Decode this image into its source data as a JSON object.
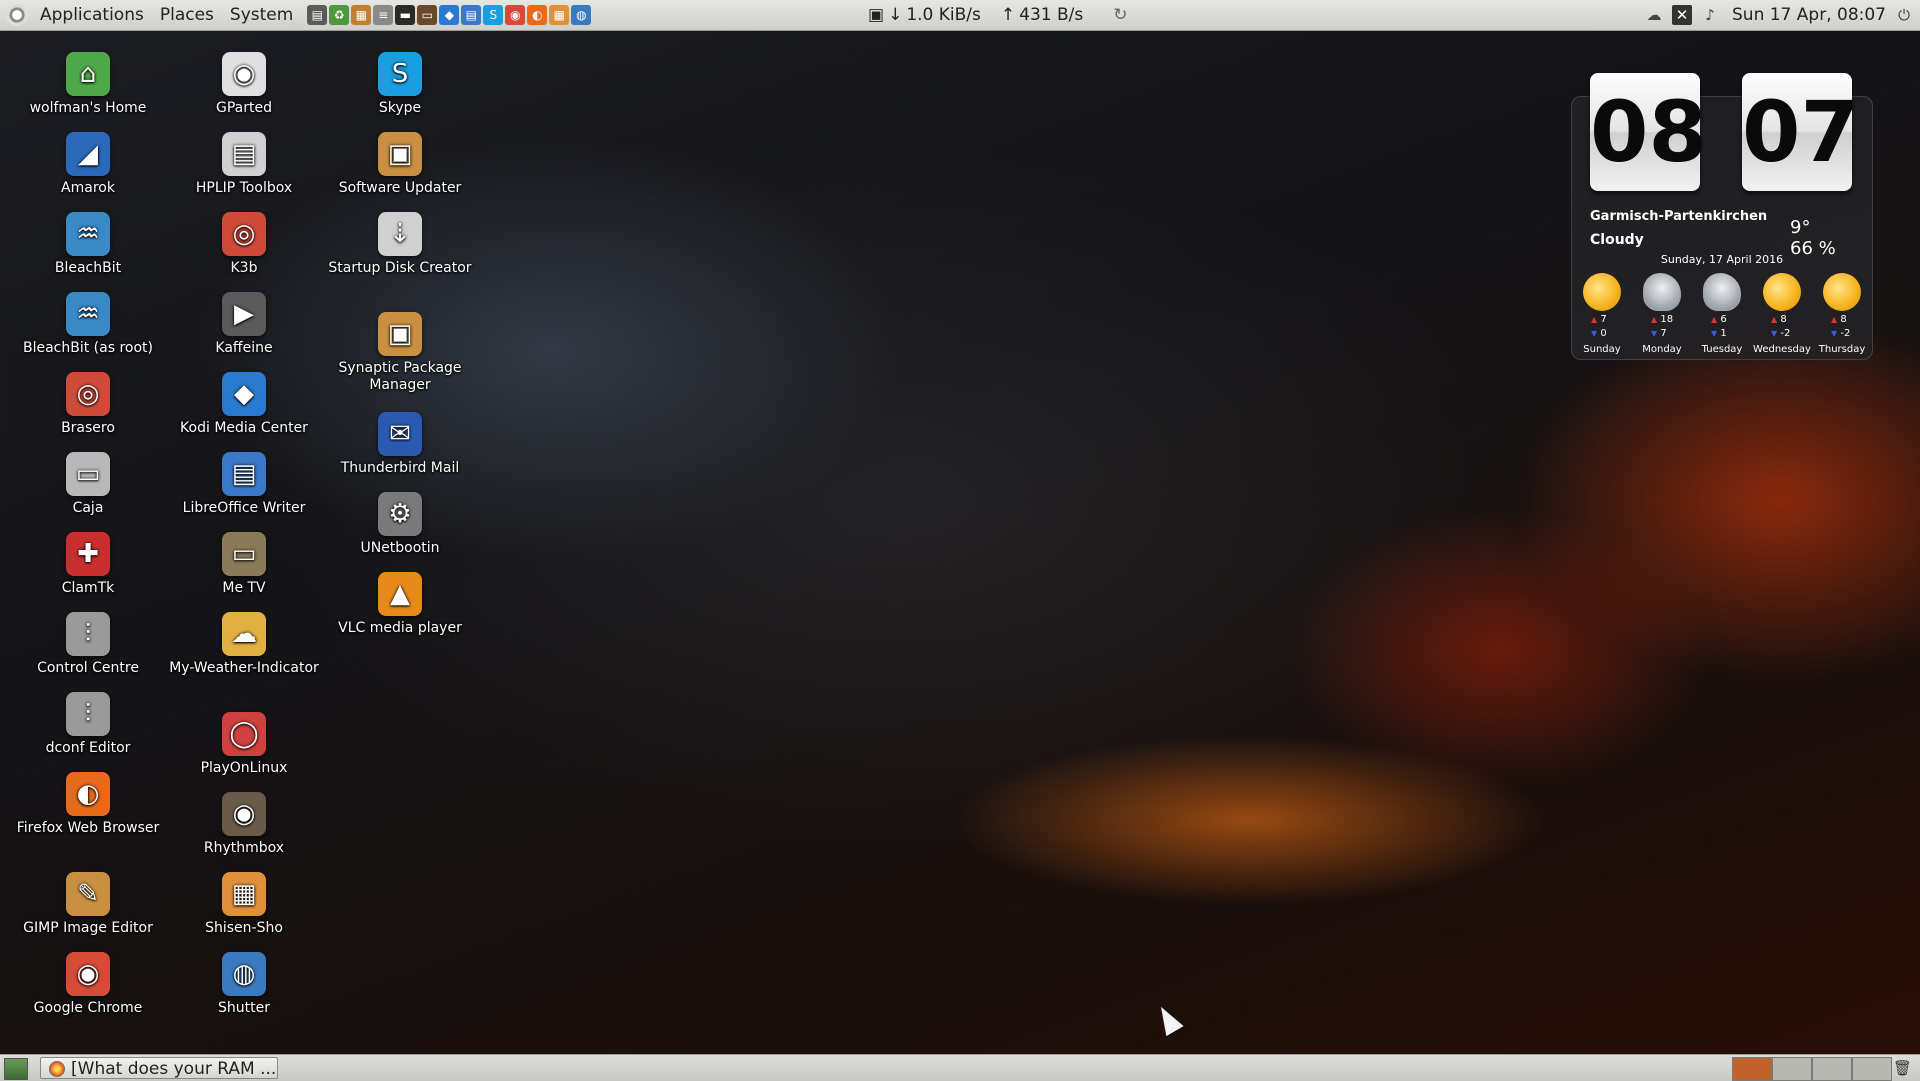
{
  "top_panel": {
    "menus": [
      "Applications",
      "Places",
      "System"
    ],
    "launchers": [
      {
        "icon": "terminal-icon",
        "glyph": "▤",
        "color": "#5a5a5a"
      },
      {
        "icon": "recycle-icon",
        "glyph": "♻",
        "color": "#4d9a3a"
      },
      {
        "icon": "image-viewer-icon",
        "glyph": "▦",
        "color": "#c08030"
      },
      {
        "icon": "text-editor-icon",
        "glyph": "≡",
        "color": "#8a8a8a"
      },
      {
        "icon": "console-icon",
        "glyph": "▬",
        "color": "#2a2a2a"
      },
      {
        "icon": "monitor-icon",
        "glyph": "▭",
        "color": "#6a4a2a"
      },
      {
        "icon": "kodi-icon",
        "glyph": "◆",
        "color": "#2a7ad0"
      },
      {
        "icon": "writer-icon",
        "glyph": "▤",
        "color": "#3a78c8"
      },
      {
        "icon": "skype-icon",
        "glyph": "S",
        "color": "#1a9ee0"
      },
      {
        "icon": "chrome-icon",
        "glyph": "◉",
        "color": "#d84a38"
      },
      {
        "icon": "firefox-icon",
        "glyph": "◐",
        "color": "#e8691a"
      },
      {
        "icon": "shisen-icon",
        "glyph": "▦",
        "color": "#e0903a"
      },
      {
        "icon": "shutter-icon",
        "glyph": "◍",
        "color": "#3a7ac0"
      }
    ],
    "net_down": "1.0 KiB/s",
    "net_up": "431 B/s",
    "clock": "Sun 17 Apr, 08:07"
  },
  "desktop_icons": [
    {
      "label": "wolfman's Home",
      "glyph": "⌂",
      "color": "#4ea84a"
    },
    {
      "label": "Amarok",
      "glyph": "◢",
      "color": "#2a6ab8"
    },
    {
      "label": "BleachBit",
      "glyph": "♒",
      "color": "#3a8ac8"
    },
    {
      "label": "BleachBit (as root)",
      "glyph": "♒",
      "color": "#3a8ac8"
    },
    {
      "label": "Brasero",
      "glyph": "◎",
      "color": "#d04a3a"
    },
    {
      "label": "Caja",
      "glyph": "▭",
      "color": "#b8b8b8"
    },
    {
      "label": "ClamTk",
      "glyph": "✚",
      "color": "#c83030"
    },
    {
      "label": "Control Centre",
      "glyph": "⫶",
      "color": "#9a9a9a"
    },
    {
      "label": "dconf Editor",
      "glyph": "⫶",
      "color": "#9a9a9a"
    },
    {
      "label": "Firefox Web Browser",
      "glyph": "◐",
      "color": "#e8691a"
    },
    {
      "label": "GIMP Image Editor",
      "glyph": "✎",
      "color": "#c89040"
    },
    {
      "label": "Google Chrome",
      "glyph": "◉",
      "color": "#d84a38"
    },
    {
      "label": "GParted",
      "glyph": "◉",
      "color": "#e0e0e0"
    },
    {
      "label": "HPLIP Toolbox",
      "glyph": "▤",
      "color": "#d0d0d0"
    },
    {
      "label": "K3b",
      "glyph": "◎",
      "color": "#d04a3a"
    },
    {
      "label": "Kaffeine",
      "glyph": "▶",
      "color": "#5a5a5a"
    },
    {
      "label": "Kodi Media Center",
      "glyph": "◆",
      "color": "#2a7ad0"
    },
    {
      "label": "LibreOffice Writer",
      "glyph": "▤",
      "color": "#3a78c8"
    },
    {
      "label": "Me TV",
      "glyph": "▭",
      "color": "#8a7a5a"
    },
    {
      "label": "My-Weather-Indicator",
      "glyph": "☁",
      "color": "#e0b040"
    },
    {
      "label": "PlayOnLinux",
      "glyph": "◯",
      "color": "#d04040"
    },
    {
      "label": "Rhythmbox",
      "glyph": "◉",
      "color": "#6a5a4a"
    },
    {
      "label": "Shisen-Sho",
      "glyph": "▦",
      "color": "#e0903a"
    },
    {
      "label": "Shutter",
      "glyph": "◍",
      "color": "#3a7ac0"
    },
    {
      "label": "Skype",
      "glyph": "S",
      "color": "#1a9ee0"
    },
    {
      "label": "Software Updater",
      "glyph": "▣",
      "color": "#c89040"
    },
    {
      "label": "Startup Disk Creator",
      "glyph": "⇣",
      "color": "#d0d0d0"
    },
    {
      "label": "Synaptic Package Manager",
      "glyph": "▣",
      "color": "#c89040"
    },
    {
      "label": "Thunderbird Mail",
      "glyph": "✉",
      "color": "#2a5ab0"
    },
    {
      "label": "UNetbootin",
      "glyph": "⚙",
      "color": "#7a7a7a"
    },
    {
      "label": "VLC media player",
      "glyph": "▲",
      "color": "#e88a1a"
    }
  ],
  "weather": {
    "hours": "08",
    "minutes": "07",
    "location": "Garmisch-Partenkirchen",
    "condition": "Cloudy",
    "temperature": "9°",
    "humidity": "66 %",
    "date": "Sunday, 17 April 2016",
    "forecast": [
      {
        "day": "Sunday",
        "high": "7",
        "low": "0",
        "icon": "sun"
      },
      {
        "day": "Monday",
        "high": "18",
        "low": "7",
        "icon": "cloud"
      },
      {
        "day": "Tuesday",
        "high": "6",
        "low": "1",
        "icon": "cloud"
      },
      {
        "day": "Wednesday",
        "high": "8",
        "low": "-2",
        "icon": "sun"
      },
      {
        "day": "Thursday",
        "high": "8",
        "low": "-2",
        "icon": "sun"
      }
    ]
  },
  "bottom_panel": {
    "task_label": "[What does your RAM ...",
    "workspaces": 4,
    "active_workspace": 1
  }
}
